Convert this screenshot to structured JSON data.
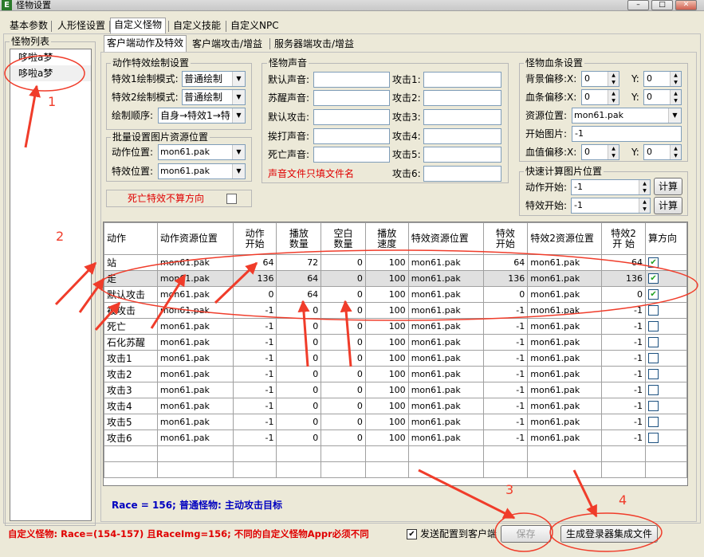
{
  "window": {
    "title": "怪物设置",
    "icon_letter": "E"
  },
  "tabs": [
    "基本参数",
    "人形怪设置",
    "自定义怪物",
    "自定义技能",
    "自定义NPC"
  ],
  "monster_list": {
    "title": "怪物列表",
    "items": [
      "哆啦a梦",
      "哆啦a梦"
    ]
  },
  "subtabs": [
    "客户端动作及特效",
    "客户端攻击/增益",
    "服务器端攻击/增益"
  ],
  "action_effects": {
    "title": "动作特效绘制设置",
    "mode1_label": "特效1绘制模式:",
    "mode1_value": "普通绘制",
    "mode2_label": "特效2绘制模式:",
    "mode2_value": "普通绘制",
    "order_label": "绘制顺序:",
    "order_value": "自身→特效1→特"
  },
  "batch": {
    "title": "批量设置图片资源位置",
    "action_label": "动作位置:",
    "action_value": "mon61.pak",
    "effect_label": "特效位置:",
    "effect_value": "mon61.pak"
  },
  "death_effect": {
    "label": "死亡特效不算方向"
  },
  "sound": {
    "title": "怪物声音",
    "default_label": "默认声音:",
    "wake_label": "苏醒声音:",
    "default_attack_label": "默认攻击:",
    "hit_label": "挨打声音:",
    "death_label": "死亡声音:",
    "attack_labels": [
      "攻击1:",
      "攻击2:",
      "攻击3:",
      "攻击4:",
      "攻击5:",
      "攻击6:"
    ],
    "note": "声音文件只填文件名"
  },
  "hpbar": {
    "title": "怪物血条设置",
    "bg_offset_label": "背景偏移:X:",
    "bg_x": "0",
    "bg_y_label": "Y:",
    "bg_y": "0",
    "bar_offset_label": "血条偏移:X:",
    "bar_x": "0",
    "bar_y_label": "Y:",
    "bar_y": "0",
    "resource_label": "资源位置:",
    "resource_value": "mon61.pak",
    "start_image_label": "开始图片:",
    "start_image_value": "-1",
    "value_offset_label": "血值偏移:X:",
    "value_x": "0",
    "value_y_label": "Y:",
    "value_y": "0"
  },
  "quick_calc": {
    "title": "快速计算图片位置",
    "action_start_label": "动作开始:",
    "action_start_value": "-1",
    "effect_start_label": "特效开始:",
    "effect_start_value": "-1",
    "calc_button": "计算"
  },
  "grid": {
    "headers": [
      "动作",
      "动作资源位置",
      "动作\n开始",
      "播放\n数量",
      "空白\n数量",
      "播放\n速度",
      "特效资源位置",
      "特效\n开始",
      "特效2资源位置",
      "特效2\n开 始",
      "算方向"
    ],
    "rows": [
      [
        "站",
        "mon61.pak",
        "64",
        "72",
        "0",
        "100",
        "mon61.pak",
        "64",
        "mon61.pak",
        "64",
        true
      ],
      [
        "走",
        "mon61.pak",
        "136",
        "64",
        "0",
        "100",
        "mon61.pak",
        "136",
        "mon61.pak",
        "136",
        true
      ],
      [
        "默认攻击",
        "mon61.pak",
        "0",
        "64",
        "0",
        "100",
        "mon61.pak",
        "0",
        "mon61.pak",
        "0",
        true
      ],
      [
        "被攻击",
        "mon61.pak",
        "-1",
        "0",
        "0",
        "100",
        "mon61.pak",
        "-1",
        "mon61.pak",
        "-1",
        false
      ],
      [
        "死亡",
        "mon61.pak",
        "-1",
        "0",
        "0",
        "100",
        "mon61.pak",
        "-1",
        "mon61.pak",
        "-1",
        false
      ],
      [
        "石化苏醒",
        "mon61.pak",
        "-1",
        "0",
        "0",
        "100",
        "mon61.pak",
        "-1",
        "mon61.pak",
        "-1",
        false
      ],
      [
        "攻击1",
        "mon61.pak",
        "-1",
        "0",
        "0",
        "100",
        "mon61.pak",
        "-1",
        "mon61.pak",
        "-1",
        false
      ],
      [
        "攻击2",
        "mon61.pak",
        "-1",
        "0",
        "0",
        "100",
        "mon61.pak",
        "-1",
        "mon61.pak",
        "-1",
        false
      ],
      [
        "攻击3",
        "mon61.pak",
        "-1",
        "0",
        "0",
        "100",
        "mon61.pak",
        "-1",
        "mon61.pak",
        "-1",
        false
      ],
      [
        "攻击4",
        "mon61.pak",
        "-1",
        "0",
        "0",
        "100",
        "mon61.pak",
        "-1",
        "mon61.pak",
        "-1",
        false
      ],
      [
        "攻击5",
        "mon61.pak",
        "-1",
        "0",
        "0",
        "100",
        "mon61.pak",
        "-1",
        "mon61.pak",
        "-1",
        false
      ],
      [
        "攻击6",
        "mon61.pak",
        "-1",
        "0",
        "0",
        "100",
        "mon61.pak",
        "-1",
        "mon61.pak",
        "-1",
        false
      ]
    ],
    "selected_row": 1
  },
  "race_info": "Race = 156; 普通怪物: 主动攻击目标",
  "footer": {
    "warning": "自定义怪物: Race=(154-157) 且RaceImg=156; 不同的自定义怪物Appr必须不同",
    "send_label": "发送配置到客户端",
    "save_button": "保存",
    "generate_button": "生成登录器集成文件"
  },
  "annotations": {
    "marks": [
      "1",
      "2",
      "3",
      "4"
    ],
    "color": "#f03c2a"
  }
}
